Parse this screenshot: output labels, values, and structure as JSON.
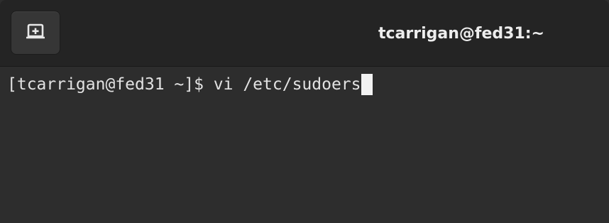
{
  "titlebar": {
    "title": "tcarrigan@fed31:~",
    "new_tab_icon": "new-tab-icon"
  },
  "terminal": {
    "prompt": "[tcarrigan@fed31 ~]$ ",
    "command": "vi /etc/sudoers"
  },
  "colors": {
    "titlebar_bg": "#242424",
    "terminal_bg": "#2d2d2d",
    "text": "#e2e2e2",
    "cursor": "#f2f2f2"
  }
}
